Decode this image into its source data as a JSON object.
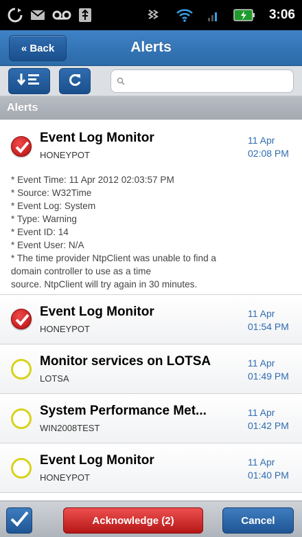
{
  "status_bar": {
    "time": "3:06",
    "icons": [
      "sync-icon",
      "mail-icon",
      "voicemail-icon",
      "usb-icon",
      "vibrate-icon",
      "wifi-icon",
      "signal-icon",
      "battery-icon"
    ]
  },
  "header": {
    "back_label": "« Back",
    "title": "Alerts"
  },
  "toolbar": {
    "search_placeholder": "",
    "icons": [
      "sort-icon",
      "refresh-icon",
      "search-icon"
    ]
  },
  "section": {
    "title": "Alerts"
  },
  "alerts": [
    {
      "title": "Event Log Monitor",
      "source": "HONEYPOT",
      "date": "11 Apr",
      "time": "02:08 PM",
      "status": "selected",
      "details": [
        "* Event Time: 11 Apr 2012 02:03:57 PM",
        "* Source: W32Time",
        "* Event Log: System",
        "* Type: Warning",
        "* Event ID: 14",
        "* Event User: N/A",
        "* The time provider NtpClient was unable to find a",
        "domain controller to use as a time",
        "source. NtpClient will try again in 30 minutes."
      ]
    },
    {
      "title": "Event Log Monitor",
      "source": "HONEYPOT",
      "date": "11 Apr",
      "time": "01:54 PM",
      "status": "selected"
    },
    {
      "title": "Monitor services on LOTSA",
      "source": "LOTSA",
      "date": "11 Apr",
      "time": "01:49 PM",
      "status": "unselected"
    },
    {
      "title": "System Performance Met...",
      "source": "WIN2008TEST",
      "date": "11 Apr",
      "time": "01:42 PM",
      "status": "unselected"
    },
    {
      "title": "Event Log Monitor",
      "source": "HONEYPOT",
      "date": "11 Apr",
      "time": "01:40 PM",
      "status": "unselected"
    }
  ],
  "bottom_bar": {
    "acknowledge_label": "Acknowledge (2)",
    "cancel_label": "Cancel"
  },
  "colors": {
    "accent_blue": "#2c6aa8",
    "acknowledge_red": "#c62222",
    "pending_yellow": "#d8d21a"
  }
}
